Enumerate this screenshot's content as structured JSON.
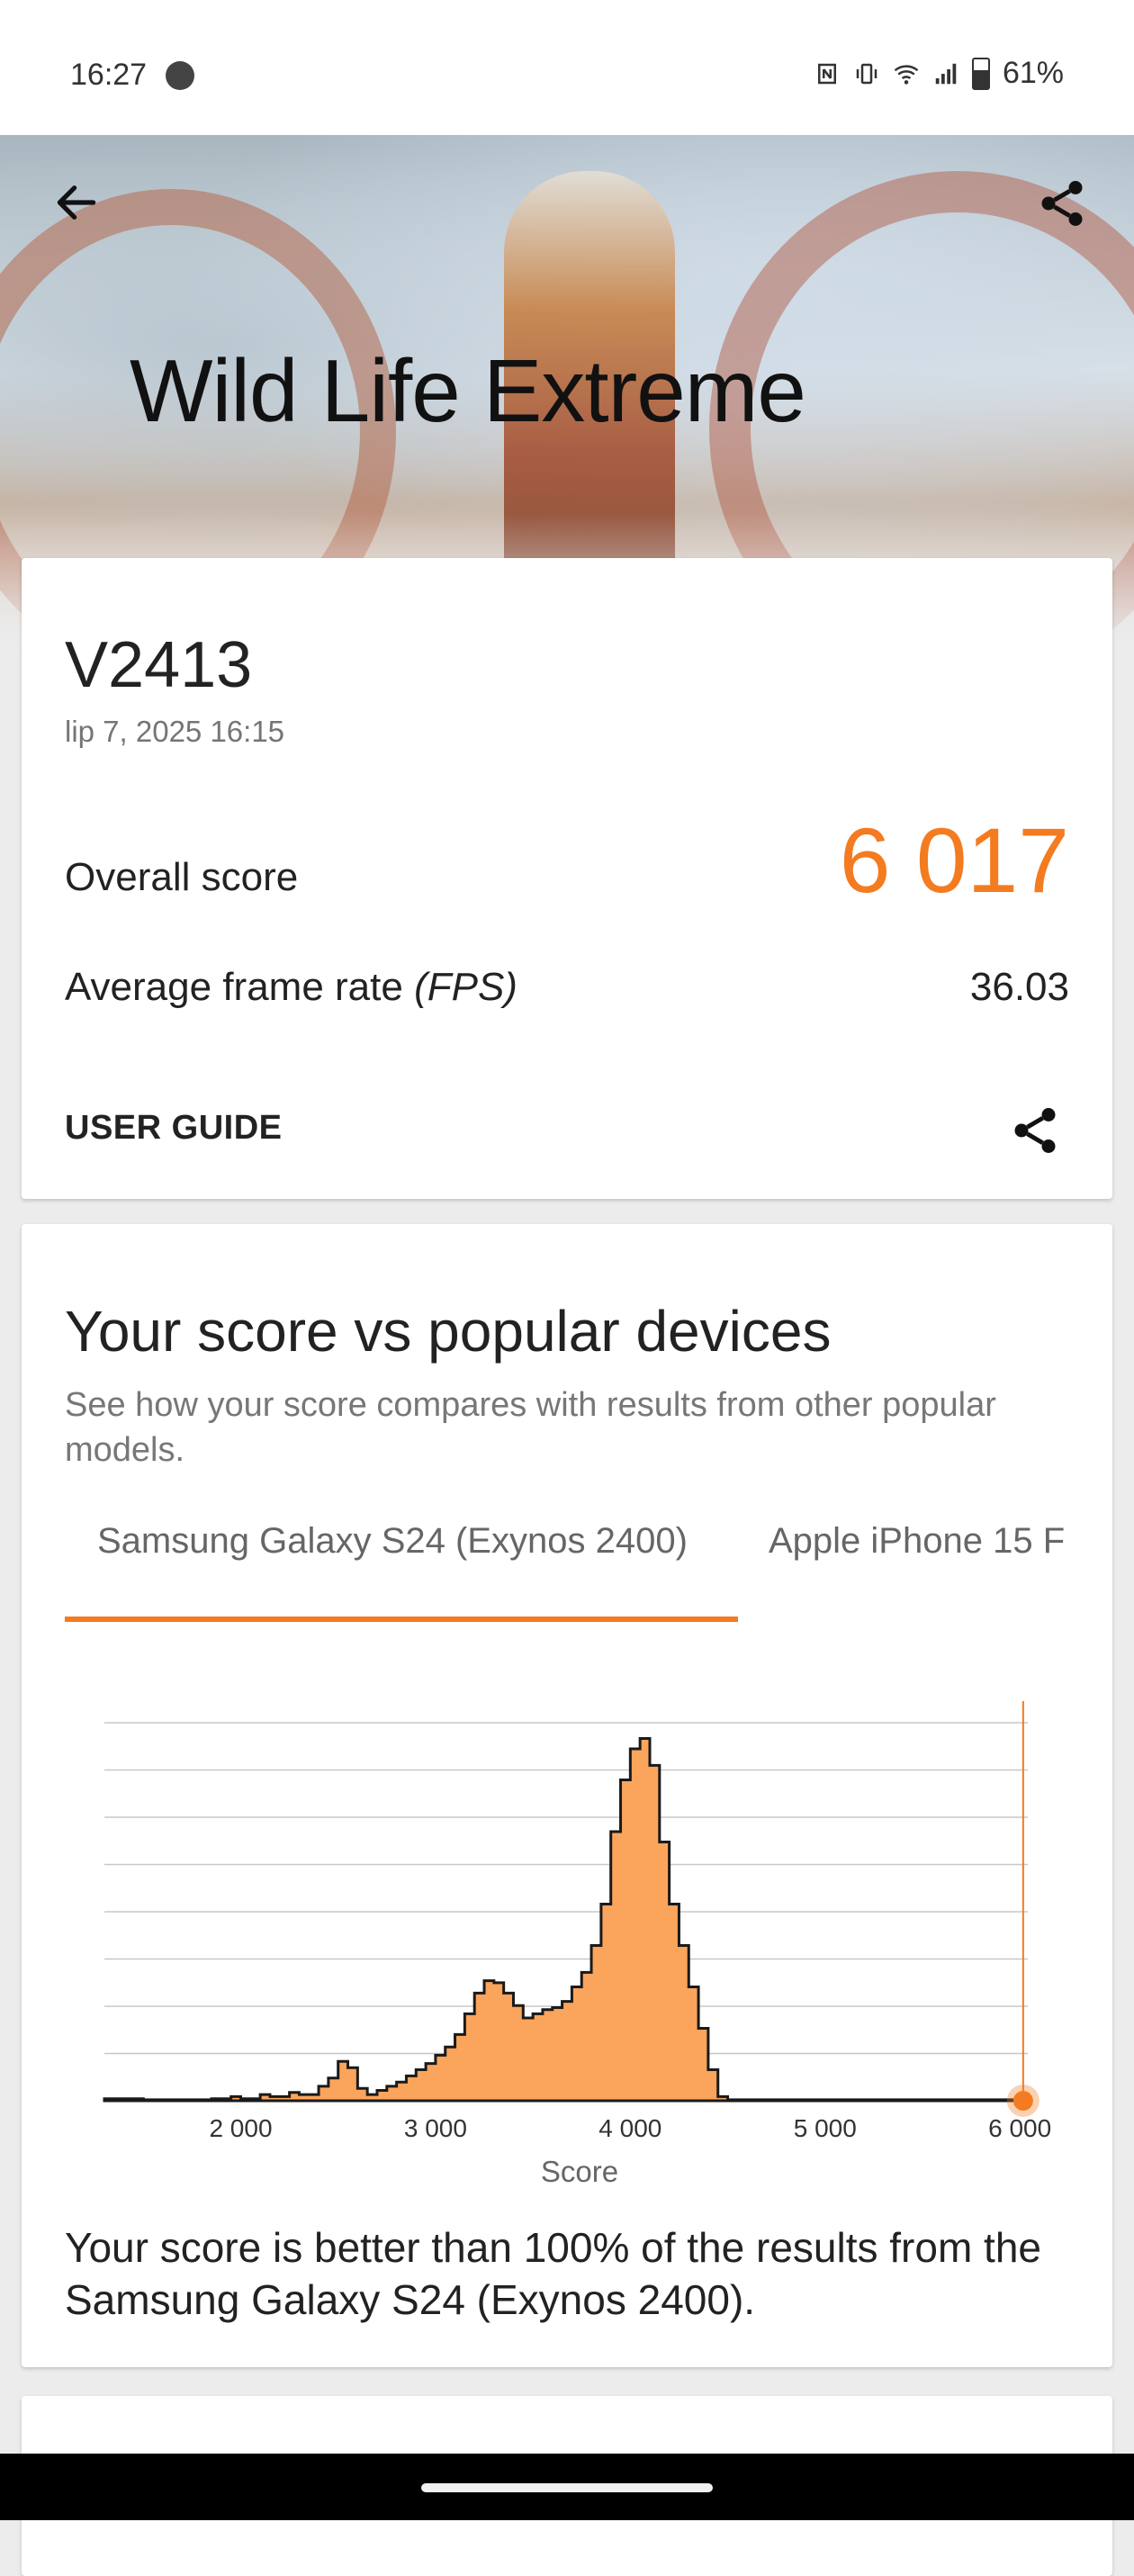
{
  "status_bar": {
    "time": "16:27",
    "battery": "61%",
    "icons": [
      "messenger-icon",
      "nfc-icon",
      "vibrate-icon",
      "wifi-icon",
      "signal-icon",
      "battery-icon"
    ]
  },
  "hero": {
    "title": "Wild Life Extreme",
    "back_icon": "arrow-left-icon",
    "share_icon": "share-icon"
  },
  "result_card": {
    "device": "V2413",
    "datetime": "lip 7, 2025 16:15",
    "overall_label": "Overall score",
    "overall_value": "6 017",
    "fps_label_prefix": "Average frame rate ",
    "fps_label_unit": "(FPS)",
    "fps_value": "36.03",
    "user_guide": "USER GUIDE"
  },
  "comparison": {
    "title": "Your score vs popular devices",
    "subtitle": "See how your score compares with results from other popular models.",
    "tabs": [
      {
        "label": "Samsung Galaxy S24 (Exynos 2400)",
        "selected": true
      },
      {
        "label": "Apple iPhone 15 F",
        "selected": false
      }
    ],
    "result_text": "Your score is better than 100% of the results from the Samsung Galaxy S24 (Exynos 2400)."
  },
  "colors": {
    "accent": "#f47b20",
    "histogram_fill": "#fba45c"
  },
  "chart_data": {
    "type": "area",
    "xlabel": "Score",
    "xlim": [
      1300,
      6050
    ],
    "x_ticks": [
      "2 000",
      "3 000",
      "4 000",
      "5 000",
      "6 000"
    ],
    "x_tick_values": [
      2000,
      3000,
      4000,
      5000,
      6000
    ],
    "grid": true,
    "your_score": 6017,
    "series": [
      {
        "values": [
          [
            1300,
            1
          ],
          [
            1500,
            0.5
          ],
          [
            1800,
            0.5
          ],
          [
            1850,
            1
          ],
          [
            1950,
            2
          ],
          [
            2000,
            1
          ],
          [
            2100,
            3
          ],
          [
            2150,
            2
          ],
          [
            2250,
            4
          ],
          [
            2300,
            3
          ],
          [
            2400,
            7
          ],
          [
            2450,
            11
          ],
          [
            2500,
            19
          ],
          [
            2550,
            16
          ],
          [
            2600,
            6
          ],
          [
            2650,
            3
          ],
          [
            2700,
            5
          ],
          [
            2750,
            7
          ],
          [
            2800,
            9
          ],
          [
            2850,
            12
          ],
          [
            2900,
            15
          ],
          [
            2950,
            18
          ],
          [
            3000,
            22
          ],
          [
            3050,
            26
          ],
          [
            3100,
            32
          ],
          [
            3150,
            42
          ],
          [
            3200,
            52
          ],
          [
            3250,
            58
          ],
          [
            3300,
            57
          ],
          [
            3350,
            52
          ],
          [
            3400,
            46
          ],
          [
            3450,
            40
          ],
          [
            3500,
            42
          ],
          [
            3550,
            44
          ],
          [
            3600,
            45
          ],
          [
            3650,
            48
          ],
          [
            3700,
            55
          ],
          [
            3750,
            62
          ],
          [
            3800,
            75
          ],
          [
            3850,
            95
          ],
          [
            3900,
            130
          ],
          [
            3950,
            155
          ],
          [
            4000,
            170
          ],
          [
            4050,
            175
          ],
          [
            4100,
            162
          ],
          [
            4150,
            125
          ],
          [
            4200,
            95
          ],
          [
            4250,
            75
          ],
          [
            4300,
            55
          ],
          [
            4350,
            35
          ],
          [
            4400,
            15
          ],
          [
            4450,
            2
          ],
          [
            4500,
            0.5
          ],
          [
            6050,
            0.5
          ]
        ]
      }
    ]
  }
}
